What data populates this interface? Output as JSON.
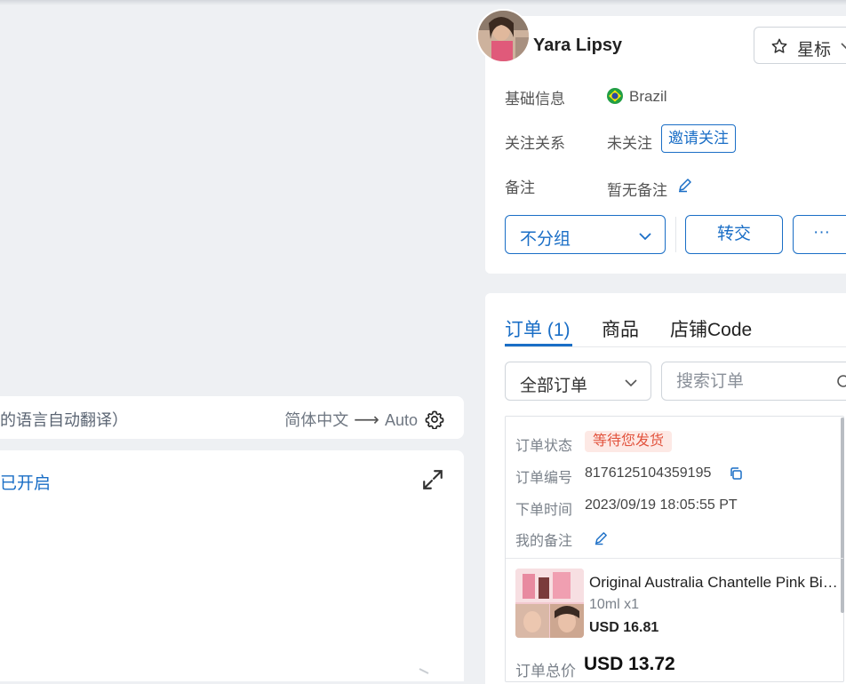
{
  "translate": {
    "hint": "的语言自动翻译）",
    "from": "简体中文",
    "arrow": "⟶",
    "to": "Auto"
  },
  "editor": {
    "status": "已开启"
  },
  "profile": {
    "name": "Yara Lipsy",
    "star_label": "星标",
    "basic_label": "基础信息",
    "country": "Brazil",
    "follow_label": "关注关系",
    "follow_value": "未关注",
    "invite_label": "邀请关注",
    "remark_label": "备注",
    "remark_value": "暂无备注",
    "group_label": "不分组",
    "transfer_label": "转交",
    "more_label": "···"
  },
  "orders": {
    "tabs": [
      {
        "label": "订单 (1)",
        "active": true
      },
      {
        "label": "商品",
        "active": false
      },
      {
        "label": "店铺Code",
        "active": false
      }
    ],
    "filter_label": "全部订单",
    "search_placeholder": "搜索订单",
    "status_label": "订单状态",
    "status_value": "等待您发货",
    "number_label": "订单编号",
    "number_value": "8176125104359195",
    "time_label": "下单时间",
    "time_value": "2023/09/19 18:05:55 PT",
    "note_label": "我的备注",
    "product": {
      "name": "Original Australia Chantelle Pink Bio...",
      "spec": "10ml x1",
      "price": "USD 16.81"
    },
    "total_label": "订单总价",
    "total_value": "USD 13.72"
  },
  "colors": {
    "accent": "#1a6ec6",
    "badge_bg": "#fde9e5",
    "badge_text": "#e2543e"
  }
}
